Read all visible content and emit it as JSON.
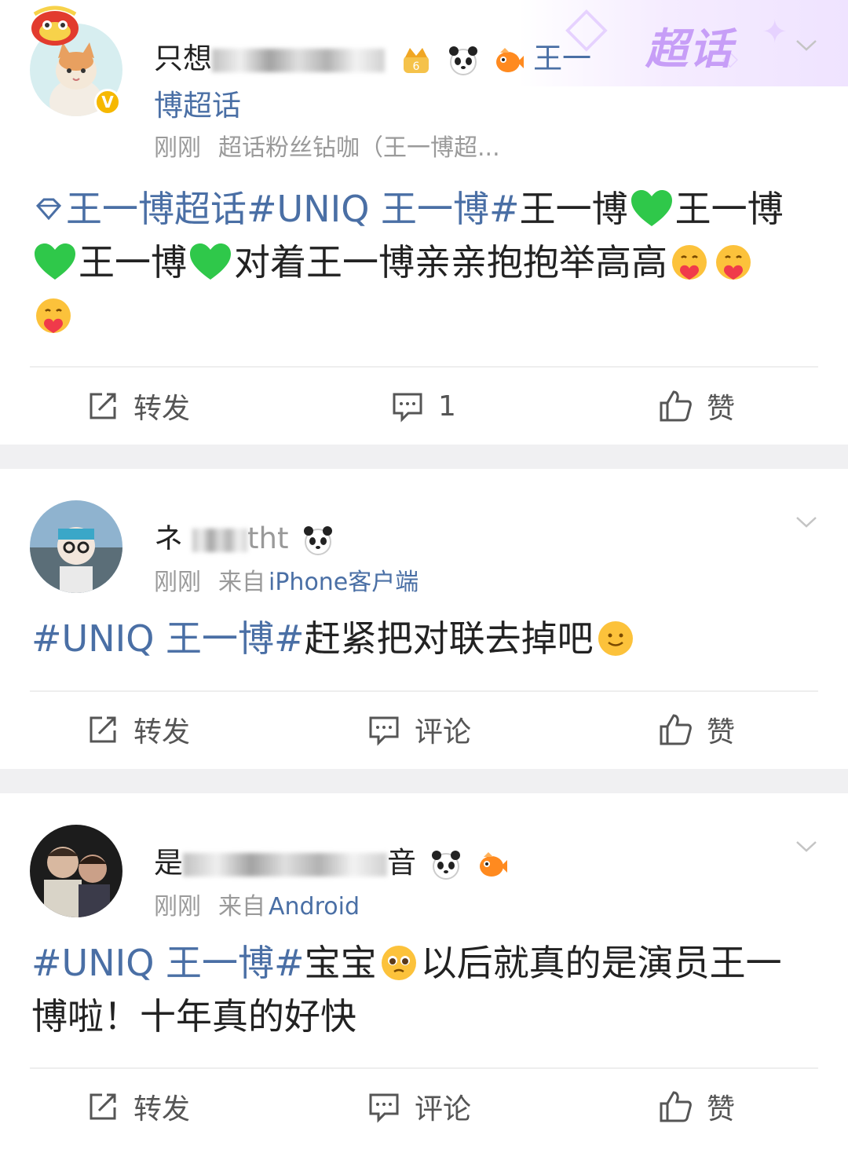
{
  "super_topic_label": "超话",
  "posts": [
    {
      "username_visible_start": "只想",
      "username_link": "王一",
      "username_line2": "博超话",
      "badges": [
        "crown-level-icon",
        "panda-icon",
        "fish-icon"
      ],
      "time": "刚刚",
      "source": "超话粉丝钻咖（王一博超...",
      "content": {
        "tag1": "王一博超话",
        "tag2": "#UNIQ 王一博#",
        "text1": "王一博",
        "text2": "王一博",
        "text3": "王一博",
        "text4": "对着王一博亲亲抱抱举高高"
      },
      "actions": {
        "repost": "转发",
        "comment": "1",
        "like": "赞"
      }
    },
    {
      "username_visible_start": "ネ",
      "username_visible_end": "tht",
      "badges": [
        "panda-icon"
      ],
      "time": "刚刚",
      "source_prefix": "来自",
      "source_link": "iPhone客户端",
      "content": {
        "tag": "#UNIQ 王一博#",
        "text": "赶紧把对联去掉吧"
      },
      "actions": {
        "repost": "转发",
        "comment": "评论",
        "like": "赞"
      }
    },
    {
      "username_visible_start": "是",
      "username_visible_end": "音",
      "badges": [
        "panda-icon",
        "fish-icon"
      ],
      "time": "刚刚",
      "source_prefix": "来自",
      "source_link": "Android",
      "content": {
        "tag": "#UNIQ 王一博#",
        "text1": "宝宝",
        "text2": "以后就真的是演员王一博啦！十年真的好快"
      },
      "actions": {
        "repost": "转发",
        "comment": "评论",
        "like": "赞"
      }
    }
  ],
  "colors": {
    "link": "#4a6fa5",
    "super_topic": "#c79ef7",
    "bg": "#f0f0f2",
    "green_heart": "#2fc84a"
  }
}
